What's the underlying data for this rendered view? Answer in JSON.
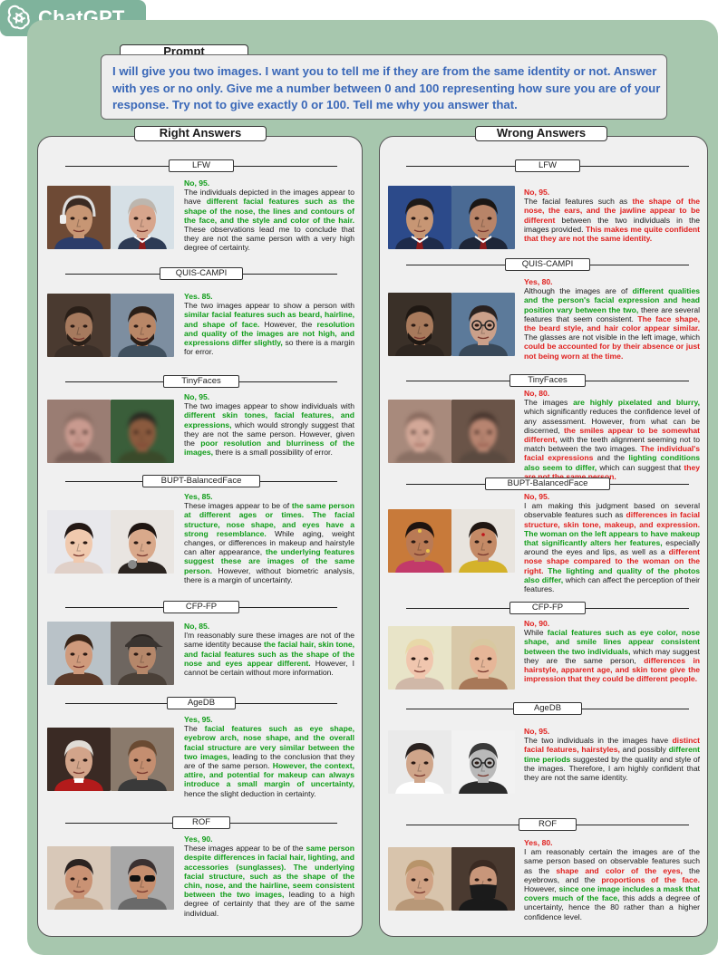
{
  "brand": {
    "name": "ChatGPT",
    "logo_icon": "openai-logo-icon",
    "tab_color": "#7fb39c",
    "panel_color": "#a7c7ae"
  },
  "prompt": {
    "label": "Prompt",
    "text": "I will give you two images. I want you to tell me if they are from the same identity or not. Answer with yes or no only. Give me a number between 0 and 100 representing how sure you are of your response. Try not to give exactly 0 or 100. Tell me why you answer that."
  },
  "columns": {
    "right": "Right Answers",
    "wrong": "Wrong Answers"
  },
  "colors": {
    "correct": "#0f9c18",
    "incorrect": "#e0201e",
    "prompt_text": "#3a68b8"
  },
  "right": [
    {
      "dataset": "LFW",
      "answer": "No, 95.",
      "verdict": "correct",
      "segments": [
        {
          "s": "The individuals depicted in the images appear to have ",
          "c": ""
        },
        {
          "s": "different facial features such as the shape of the nose, the lines and contours of the face, and the style and color of the hair.",
          "c": "g"
        },
        {
          "s": " These observations lead me to conclude that they are not the same person with a very high degree of certainty.",
          "c": ""
        }
      ]
    },
    {
      "dataset": "QUIS-CAMPI",
      "answer": "Yes. 85.",
      "verdict": "correct",
      "segments": [
        {
          "s": "The two images appear to show a person with ",
          "c": ""
        },
        {
          "s": "similar facial features such as beard, hairline, and shape of face.",
          "c": "g"
        },
        {
          "s": " However, the ",
          "c": ""
        },
        {
          "s": "resolution and quality of the images are not high, and expressions differ slightly,",
          "c": "g"
        },
        {
          "s": " so there is a margin for error.",
          "c": ""
        }
      ]
    },
    {
      "dataset": "TinyFaces",
      "answer": "No, 95.",
      "verdict": "correct",
      "segments": [
        {
          "s": "The two images appear to show individuals with ",
          "c": ""
        },
        {
          "s": "different skin tones, facial features, and expressions,",
          "c": "g"
        },
        {
          "s": " which would strongly suggest that they are not the same person. However, given the ",
          "c": ""
        },
        {
          "s": "poor resolution and blurriness of the images,",
          "c": "g"
        },
        {
          "s": " there is a small possibility of error.",
          "c": ""
        }
      ]
    },
    {
      "dataset": "BUPT-BalancedFace",
      "answer": "Yes, 85.",
      "verdict": "correct",
      "segments": [
        {
          "s": "These images appear to be of ",
          "c": ""
        },
        {
          "s": "the same person at different ages or times. The facial structure, nose shape, and eyes have a strong resemblance.",
          "c": "g"
        },
        {
          "s": " While aging, weight changes, or differences in makeup and hairstyle can alter appearance, ",
          "c": ""
        },
        {
          "s": "the underlying features suggest these are images of the same person.",
          "c": "g"
        },
        {
          "s": " However, without biometric analysis, there is a margin of uncertainty.",
          "c": ""
        }
      ]
    },
    {
      "dataset": "CFP-FP",
      "answer": "No, 85.",
      "verdict": "correct",
      "segments": [
        {
          "s": "I'm reasonably sure these images are not of the same identity because ",
          "c": ""
        },
        {
          "s": "the facial hair, skin tone, and facial features such as the shape of the nose and eyes appear different.",
          "c": "g"
        },
        {
          "s": " However, I cannot be certain without more information.",
          "c": ""
        }
      ]
    },
    {
      "dataset": "AgeDB",
      "answer": "Yes, 95.",
      "verdict": "correct",
      "segments": [
        {
          "s": "The ",
          "c": ""
        },
        {
          "s": "facial features such as eye shape, eyebrow arch, nose shape, and the overall facial structure are very similar between the two images,",
          "c": "g"
        },
        {
          "s": " leading to the conclusion that they are of the same person. ",
          "c": ""
        },
        {
          "s": "However, the context, attire, and potential for makeup can always introduce a small margin of uncertainty,",
          "c": "g"
        },
        {
          "s": " hence the slight deduction in certainty.",
          "c": ""
        }
      ]
    },
    {
      "dataset": "ROF",
      "answer": "Yes, 90.",
      "verdict": "correct",
      "segments": [
        {
          "s": "These images appear to be of the ",
          "c": ""
        },
        {
          "s": "same person despite differences in facial hair, lighting, and accessories (sunglasses). The underlying facial structure, such as the shape of the chin, nose, and the hairline, seem consistent between the two images,",
          "c": "g"
        },
        {
          "s": " leading to a high degree of certainty that they are of the same individual.",
          "c": ""
        }
      ]
    }
  ],
  "wrong": [
    {
      "dataset": "LFW",
      "answer": "No, 95.",
      "verdict": "incorrect",
      "segments": [
        {
          "s": "The facial features such as ",
          "c": ""
        },
        {
          "s": "the shape of the nose, the ears, and the jawline appear to be different",
          "c": "r"
        },
        {
          "s": " between the two individuals in the images provided. ",
          "c": ""
        },
        {
          "s": "This makes me quite confident that they are not the same identity.",
          "c": "r"
        }
      ]
    },
    {
      "dataset": "QUIS-CAMPI",
      "answer": "Yes, 80.",
      "verdict": "incorrect",
      "segments": [
        {
          "s": "Although the images are of ",
          "c": ""
        },
        {
          "s": "different qualities and the person's facial expression and head position vary between the two,",
          "c": "g"
        },
        {
          "s": " there are several features that seem consistent. ",
          "c": ""
        },
        {
          "s": "The face shape, the beard style, and hair color appear similar.",
          "c": "r"
        },
        {
          "s": " The glasses are not visible in the left image, which ",
          "c": ""
        },
        {
          "s": "could be accounted for by their absence or just not being worn at the time.",
          "c": "r"
        }
      ]
    },
    {
      "dataset": "TinyFaces",
      "answer": "No, 80.",
      "verdict": "incorrect",
      "segments": [
        {
          "s": "The images ",
          "c": ""
        },
        {
          "s": "are highly pixelated and blurry,",
          "c": "g"
        },
        {
          "s": " which significantly reduces the confidence level of any assessment. However, from what can be discerned, ",
          "c": ""
        },
        {
          "s": "the smiles appear to be somewhat different,",
          "c": "r"
        },
        {
          "s": " with the teeth alignment seeming not to match between the two images. ",
          "c": ""
        },
        {
          "s": "The individual's facial expressions",
          "c": "r"
        },
        {
          "s": " and the ",
          "c": ""
        },
        {
          "s": "lighting conditions also seem to differ,",
          "c": "g"
        },
        {
          "s": " which can suggest that ",
          "c": ""
        },
        {
          "s": "they are not the same person.",
          "c": "r"
        }
      ]
    },
    {
      "dataset": "BUPT-BalancedFace",
      "answer": "No, 95.",
      "verdict": "incorrect",
      "segments": [
        {
          "s": "I am making this judgment based on several observable features such as ",
          "c": ""
        },
        {
          "s": "differences in facial structure, skin tone, makeup, and expression.",
          "c": "r"
        },
        {
          "s": " ",
          "c": ""
        },
        {
          "s": "The woman on the left appears to have makeup that significantly alters her features,",
          "c": "g"
        },
        {
          "s": " especially around the eyes and lips, as well as a ",
          "c": ""
        },
        {
          "s": "different nose shape compared to the woman on the right.",
          "c": "r"
        },
        {
          "s": " ",
          "c": ""
        },
        {
          "s": "The lighting and quality of the photos also differ,",
          "c": "g"
        },
        {
          "s": " which can affect the perception of their features.",
          "c": ""
        }
      ]
    },
    {
      "dataset": "CFP-FP",
      "answer": "No, 90.",
      "verdict": "incorrect",
      "segments": [
        {
          "s": "While ",
          "c": ""
        },
        {
          "s": "facial features such as eye color, nose shape, and smile lines appear consistent between the two individuals,",
          "c": "g"
        },
        {
          "s": " which may suggest they are the same person, ",
          "c": ""
        },
        {
          "s": "differences in hairstyle, apparent age, and skin tone give the impression that they could be different people.",
          "c": "r"
        }
      ]
    },
    {
      "dataset": "AgeDB",
      "answer": "No, 95.",
      "verdict": "incorrect",
      "segments": [
        {
          "s": "The two individuals in the images have ",
          "c": ""
        },
        {
          "s": "distinct facial features, hairstyles,",
          "c": "r"
        },
        {
          "s": " and possibly ",
          "c": ""
        },
        {
          "s": "different time periods",
          "c": "g"
        },
        {
          "s": " suggested by the quality and style of the images. Therefore, I am highly confident that they are not the same identity.",
          "c": ""
        }
      ]
    },
    {
      "dataset": "ROF",
      "answer": "Yes, 80.",
      "verdict": "incorrect",
      "segments": [
        {
          "s": "I am reasonably certain the images are of the same person based on observable features such as the ",
          "c": ""
        },
        {
          "s": "shape and color of the eyes,",
          "c": "r"
        },
        {
          "s": " the eyebrows, and the ",
          "c": ""
        },
        {
          "s": "proportions of the face.",
          "c": "r"
        },
        {
          "s": " However, ",
          "c": ""
        },
        {
          "s": "since one image includes a mask that covers much of the face,",
          "c": "g"
        },
        {
          "s": " this adds a degree of uncertainty, hence the 80 rather than a higher confidence level.",
          "c": ""
        }
      ]
    }
  ],
  "faces": {
    "right": [
      [
        {
          "bg": "#6e4a35",
          "skin": "#c79674",
          "hair": "#3a2a22",
          "shirt": "#2c3d6a",
          "acc": "headset"
        },
        {
          "bg": "#d6e0e6",
          "skin": "#d7a58c",
          "hair": "#bdb6ae",
          "shirt": "#2d3b55",
          "acc": "tie"
        }
      ],
      [
        {
          "bg": "#4a3a30",
          "skin": "#a67a5e",
          "hair": "#2a1f18",
          "shirt": "#3b2f28",
          "acc": "beard"
        },
        {
          "bg": "#7d8ea0",
          "skin": "#b98767",
          "hair": "#2b1f18",
          "shirt": "#40505e",
          "acc": "beard"
        }
      ],
      [
        {
          "bg": "#9a7d73",
          "skin": "#c99a8f",
          "hair": "#8a6e64",
          "shirt": "#7a6058",
          "acc": "blur"
        },
        {
          "bg": "#3a5e3a",
          "skin": "#8a5a3e",
          "hair": "#2a2a22",
          "shirt": "#3a4a2a",
          "acc": "blur"
        }
      ],
      [
        {
          "bg": "#e8e8ec",
          "skin": "#f0c9ae",
          "hair": "#231815",
          "shirt": "#e0d0c8",
          "acc": ""
        },
        {
          "bg": "#e9e5e1",
          "skin": "#d9a98b",
          "hair": "#1f1512",
          "shirt": "#2b2420",
          "acc": "mic"
        }
      ],
      [
        {
          "bg": "#b9c2c8",
          "skin": "#cf9a7c",
          "hair": "#3a2518",
          "shirt": "#5a3a2a",
          "acc": ""
        },
        {
          "bg": "#6e6660",
          "skin": "#b5876a",
          "hair": "#2a2420",
          "shirt": "#4a4038",
          "acc": "cap"
        }
      ],
      [
        {
          "bg": "#3a2a24",
          "skin": "#d2a48a",
          "hair": "#e0dcd6",
          "shirt": "#b31b1b",
          "acc": "collar"
        },
        {
          "bg": "#8a7a6c",
          "skin": "#c48e70",
          "hair": "#6a4a32",
          "shirt": "#3a3a3a",
          "acc": ""
        }
      ],
      [
        {
          "bg": "#d8c8b8",
          "skin": "#c99274",
          "hair": "#2a2220",
          "shirt": "#c2a48a",
          "acc": ""
        },
        {
          "bg": "#a8a8a8",
          "skin": "#c68e6e",
          "hair": "#3a3030",
          "shirt": "#6a6a6a",
          "acc": "sunglasses"
        }
      ]
    ],
    "wrong": [
      [
        {
          "bg": "#2c4a8a",
          "skin": "#c79674",
          "hair": "#1f1a18",
          "shirt": "#1e2b4a",
          "acc": "tie"
        },
        {
          "bg": "#4a6a94",
          "skin": "#b88468",
          "hair": "#1a1614",
          "shirt": "#1e2638",
          "acc": "tie"
        }
      ],
      [
        {
          "bg": "#3a3028",
          "skin": "#a87a5c",
          "hair": "#1f1813",
          "shirt": "#2e2620",
          "acc": "beard"
        },
        {
          "bg": "#5c7a9a",
          "skin": "#caa08a",
          "hair": "#2a2220",
          "shirt": "#384858",
          "acc": "glasses"
        }
      ],
      [
        {
          "bg": "#a88a7c",
          "skin": "#d3a898",
          "hair": "#8a6c60",
          "shirt": "#8a7064",
          "acc": "blur"
        },
        {
          "bg": "#6a5448",
          "skin": "#b78470",
          "hair": "#4a3830",
          "shirt": "#5a4a40",
          "acc": "blur"
        }
      ],
      [
        {
          "bg": "#c87a3a",
          "skin": "#b97a55",
          "hair": "#1f1410",
          "shirt": "#c23a6a",
          "acc": "jewel"
        },
        {
          "bg": "#e8e4de",
          "skin": "#c48a66",
          "hair": "#1f1612",
          "shirt": "#d4b22a",
          "acc": "bindi"
        }
      ],
      [
        {
          "bg": "#e8e4c8",
          "skin": "#f0c6ae",
          "hair": "#e8d8a8",
          "shirt": "#d0b8a8",
          "acc": ""
        },
        {
          "bg": "#d8c8a8",
          "skin": "#e6b698",
          "hair": "#d8c8a0",
          "shirt": "#a87858",
          "acc": ""
        }
      ],
      [
        {
          "bg": "#eaeaea",
          "skin": "#cfa58a",
          "hair": "#2a2220",
          "shirt": "#ffffff",
          "acc": ""
        },
        {
          "bg": "#f2f2f2",
          "skin": "#b9b9b9",
          "hair": "#3a3a3a",
          "shirt": "#2a2a2a",
          "acc": "glasses"
        }
      ],
      [
        {
          "bg": "#d8c4ac",
          "skin": "#d0a284",
          "hair": "#b8946a",
          "shirt": "#b89878",
          "acc": ""
        },
        {
          "bg": "#4a3a30",
          "skin": "#c8967a",
          "hair": "#3a2a22",
          "shirt": "#1a1a1a",
          "acc": "mask"
        }
      ]
    ]
  }
}
